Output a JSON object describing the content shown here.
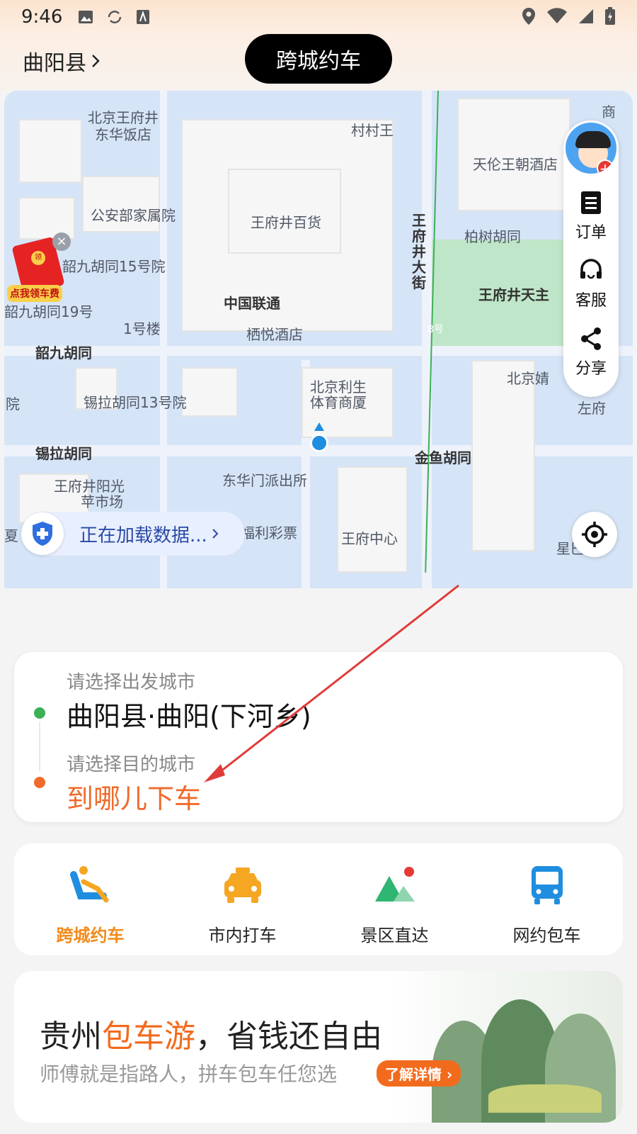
{
  "status_bar": {
    "time": "9:46"
  },
  "header": {
    "city": "曲阳县",
    "title": "跨城约车"
  },
  "map": {
    "labels": [
      "北京王府井",
      "东华饭店",
      "村村王",
      "天伦王朝酒店",
      "商",
      "公安部家属院",
      "王府井百货",
      "柏树胡同",
      "韶九胡同15号院",
      "中国联通",
      "王府井天主",
      "王府井大街",
      "韶九胡同19号",
      "1号楼",
      "栖悦酒店",
      "8号",
      "韶九胡同",
      "北京利生",
      "体育商厦",
      "北京婧",
      "锡拉胡同13号院",
      "左府",
      "院",
      "锡拉胡同",
      "金鱼胡同",
      "王府井阳光",
      "东华门派出所",
      "福利彩票",
      "王府中心",
      "星巴克",
      "夏",
      "苹市场"
    ],
    "red_packet_label": "点我领车费",
    "red_packet_coin": "领",
    "loading_text": "正在加载数据..."
  },
  "side_panel": {
    "orders": "订单",
    "service": "客服",
    "share": "分享"
  },
  "route": {
    "from_hint": "请选择出发城市",
    "from_value": "曲阳县·曲阳(下河乡)",
    "to_hint": "请选择目的城市",
    "to_value": "到哪儿下车"
  },
  "services": [
    {
      "label": "跨城约车",
      "icon": "seat-icon"
    },
    {
      "label": "市内打车",
      "icon": "taxi-icon"
    },
    {
      "label": "景区直达",
      "icon": "mountain-icon"
    },
    {
      "label": "网约包车",
      "icon": "bus-icon"
    }
  ],
  "banner": {
    "title_a": "贵州",
    "title_highlight": "包车游",
    "title_b": "，省钱还自由",
    "subtitle": "师傅就是指路人，拼车包车任您选",
    "button": "了解详情"
  },
  "colors": {
    "accent": "#f28b1c",
    "destination": "#f06a2a",
    "map_water": "#d6e4f7",
    "annotation_arrow": "#e03b3b"
  }
}
